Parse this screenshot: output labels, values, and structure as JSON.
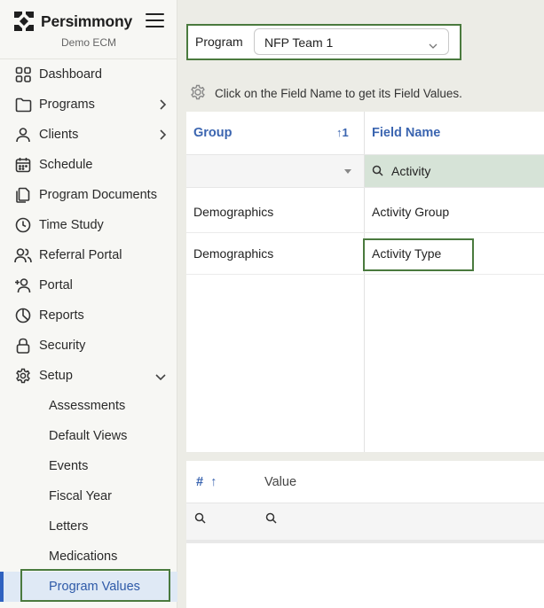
{
  "app": {
    "brand": "Persimmony",
    "org": "Demo ECM"
  },
  "sidebar": {
    "items": [
      {
        "label": "Dashboard",
        "icon": "dashboard-icon",
        "chevron": ""
      },
      {
        "label": "Programs",
        "icon": "folder-icon",
        "chevron": "right"
      },
      {
        "label": "Clients",
        "icon": "person-icon",
        "chevron": "right"
      },
      {
        "label": "Schedule",
        "icon": "calendar-icon",
        "chevron": ""
      },
      {
        "label": "Program Documents",
        "icon": "documents-icon",
        "chevron": ""
      },
      {
        "label": "Time Study",
        "icon": "clock-icon",
        "chevron": ""
      },
      {
        "label": "Referral Portal",
        "icon": "people-icon",
        "chevron": ""
      },
      {
        "label": "Portal",
        "icon": "person-add-icon",
        "chevron": ""
      },
      {
        "label": "Reports",
        "icon": "pie-chart-icon",
        "chevron": ""
      },
      {
        "label": "Security",
        "icon": "lock-icon",
        "chevron": ""
      },
      {
        "label": "Setup",
        "icon": "gear-icon",
        "chevron": "down"
      }
    ],
    "setup_items": [
      "Assessments",
      "Default Views",
      "Events",
      "Fiscal Year",
      "Letters",
      "Medications",
      "Program Values"
    ],
    "active_item": "Program Values"
  },
  "program": {
    "label": "Program",
    "value": "NFP Team 1"
  },
  "info_text": "Click on the Field Name to get its Field Values.",
  "fields_table": {
    "columns": [
      "Group",
      "Field Name"
    ],
    "sort_indicator": "↑1",
    "field_filter": "Activity",
    "rows": [
      {
        "group": "Demographics",
        "field": "Activity Group"
      },
      {
        "group": "Demographics",
        "field": "Activity Type"
      }
    ]
  },
  "values_table": {
    "columns": [
      "#",
      "Value"
    ],
    "sort_indicator": "↑"
  },
  "colors": {
    "accent": "#3b65b0",
    "highlight": "#4a7a3e",
    "filter_active": "#d6e3d7"
  }
}
